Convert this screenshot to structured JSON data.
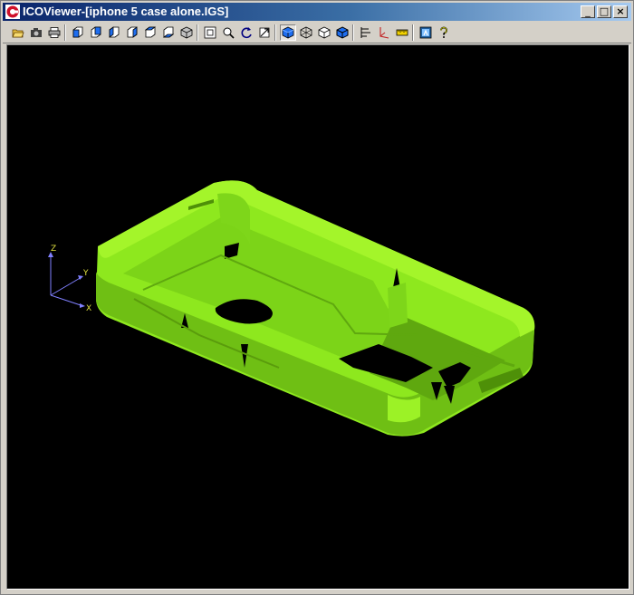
{
  "window": {
    "title": "ICOViewer-[iphone 5 case alone.IGS]",
    "controls": {
      "minimize": "_",
      "maximize": "□",
      "close": "×"
    }
  },
  "toolbar": {
    "icons": [
      "open-folder-icon",
      "camera-icon",
      "print-icon",
      "view-front-icon",
      "view-back-icon",
      "view-left-icon",
      "view-right-icon",
      "view-top-icon",
      "view-bottom-icon",
      "view-iso-icon",
      "zoom-fit-icon",
      "zoom-window-icon",
      "rotate-icon",
      "pan-icon",
      "shaded-icon",
      "wireframe-icon",
      "hidden-line-icon",
      "shaded-edges-icon",
      "tree-icon",
      "axis-icon",
      "measure-icon",
      "about-icon",
      "help-icon"
    ],
    "pressed": "shaded-icon"
  },
  "viewport": {
    "background": "#000000",
    "model_color": "#8ee81e",
    "axes": {
      "x_label": "X",
      "y_label": "Y",
      "z_label": "Z"
    }
  }
}
